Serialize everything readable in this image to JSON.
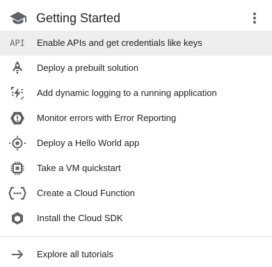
{
  "header": {
    "title": "Getting Started",
    "icon": "graduation-cap-icon",
    "menu_icon": "more-vert-icon"
  },
  "items": [
    {
      "icon": "api-icon",
      "icon_text": "API",
      "label": "Enable APIs and get credentials like keys",
      "active": true
    },
    {
      "icon": "rocket-icon",
      "label": "Deploy a prebuilt solution"
    },
    {
      "icon": "debugger-icon",
      "label": "Add dynamic logging to a running application"
    },
    {
      "icon": "error-reporting-icon",
      "label": "Monitor errors with Error Reporting"
    },
    {
      "icon": "hello-world-icon",
      "label": "Deploy a Hello World app"
    },
    {
      "icon": "vm-chip-icon",
      "label": "Take a VM quickstart"
    },
    {
      "icon": "cloud-functions-icon",
      "label": "Create a Cloud Function"
    },
    {
      "icon": "cloud-sdk-icon",
      "label": "Install the Cloud SDK"
    }
  ],
  "footer": {
    "icon": "arrow-forward-icon",
    "label": "Explore all tutorials"
  },
  "colors": {
    "icon": "#5f6368",
    "text": "#212121",
    "active_bg": "#eeeeee",
    "divider": "#e0e0e0"
  }
}
